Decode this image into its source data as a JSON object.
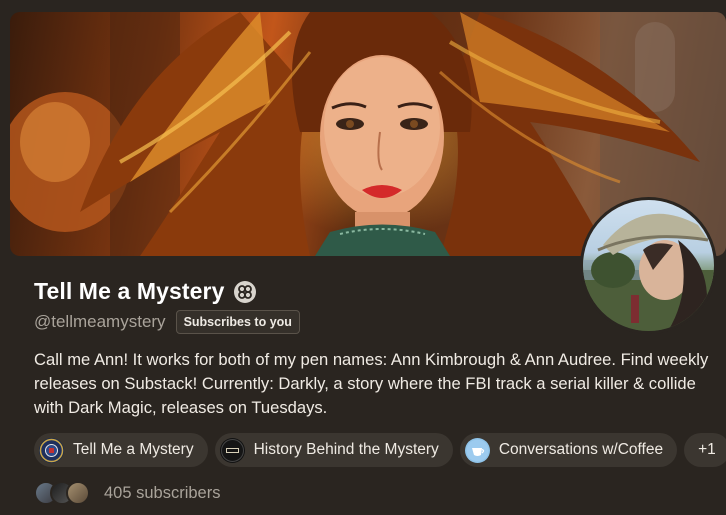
{
  "publication": {
    "title": "Tell Me a Mystery",
    "handle": "@tellmeamystery",
    "subscribes_badge": "Subscribes to you",
    "bio": "Call me Ann! It works for both of my pen names: Ann Kimbrough & Ann Audree. Find weekly releases on Substack! Currently: Darkly, a story where the FBI track a serial killer & collide with Dark Magic, releases on Tuesdays."
  },
  "publications": [
    {
      "label": "Tell Me a Mystery",
      "icon": "fbi-seal-icon"
    },
    {
      "label": "History Behind the Mystery",
      "icon": "history-logo-icon"
    },
    {
      "label": "Conversations w/Coffee",
      "icon": "coffee-logo-icon"
    }
  ],
  "more_publications": "+1",
  "subscribers": {
    "count_text": "405 subscribers"
  },
  "colors": {
    "background": "#2a2520",
    "pill": "#3b3630",
    "muted_text": "#a9a39a"
  }
}
